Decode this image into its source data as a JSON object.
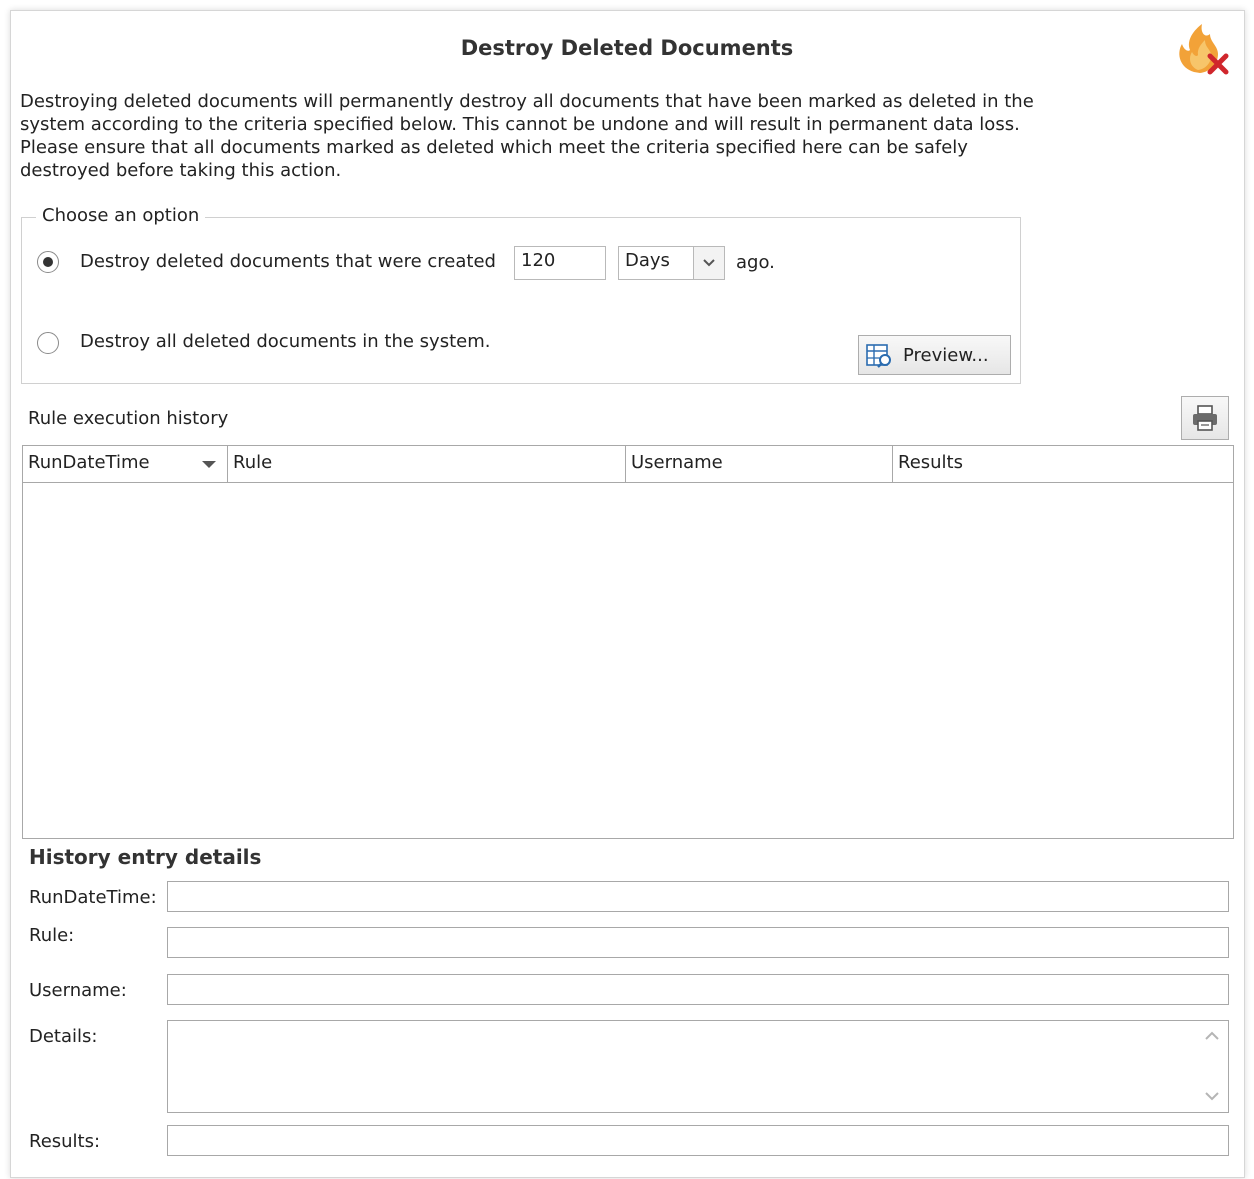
{
  "dialog": {
    "title": "Destroy Deleted Documents",
    "description": "Destroying deleted documents will permanently destroy all documents that have been marked as deleted in the system according to the criteria specified below.  This cannot be undone and will result in permanent data loss. Please ensure that all documents marked as deleted which meet the criteria specified here can be safely destroyed before taking this action."
  },
  "options": {
    "legend": "Choose an option",
    "option1_label": "Destroy deleted documents that were created",
    "option1_selected": true,
    "days_value": "120",
    "unit_value": "Days",
    "ago_label": "ago.",
    "option2_label": "Destroy all deleted documents in the system.",
    "option2_selected": false,
    "preview_button": "Preview..."
  },
  "history": {
    "label": "Rule execution history",
    "columns": [
      "RunDateTime",
      "Rule",
      "Username",
      "Results"
    ],
    "rows": []
  },
  "details": {
    "title": "History entry details",
    "labels": {
      "run_date_time": "RunDateTime:",
      "rule": "Rule:",
      "username": "Username:",
      "details": "Details:",
      "results": "Results:"
    },
    "values": {
      "run_date_time": "",
      "rule": "",
      "username": "",
      "details": "",
      "results": ""
    }
  },
  "colors": {
    "border": "#a8a8a8",
    "fire": "#f5a623",
    "close_x": "#d0262c"
  },
  "icons": [
    "fire-delete-icon",
    "chevron-down-icon",
    "preview-table-icon",
    "printer-icon",
    "sort-desc-icon",
    "scroll-up-icon",
    "scroll-down-icon"
  ]
}
